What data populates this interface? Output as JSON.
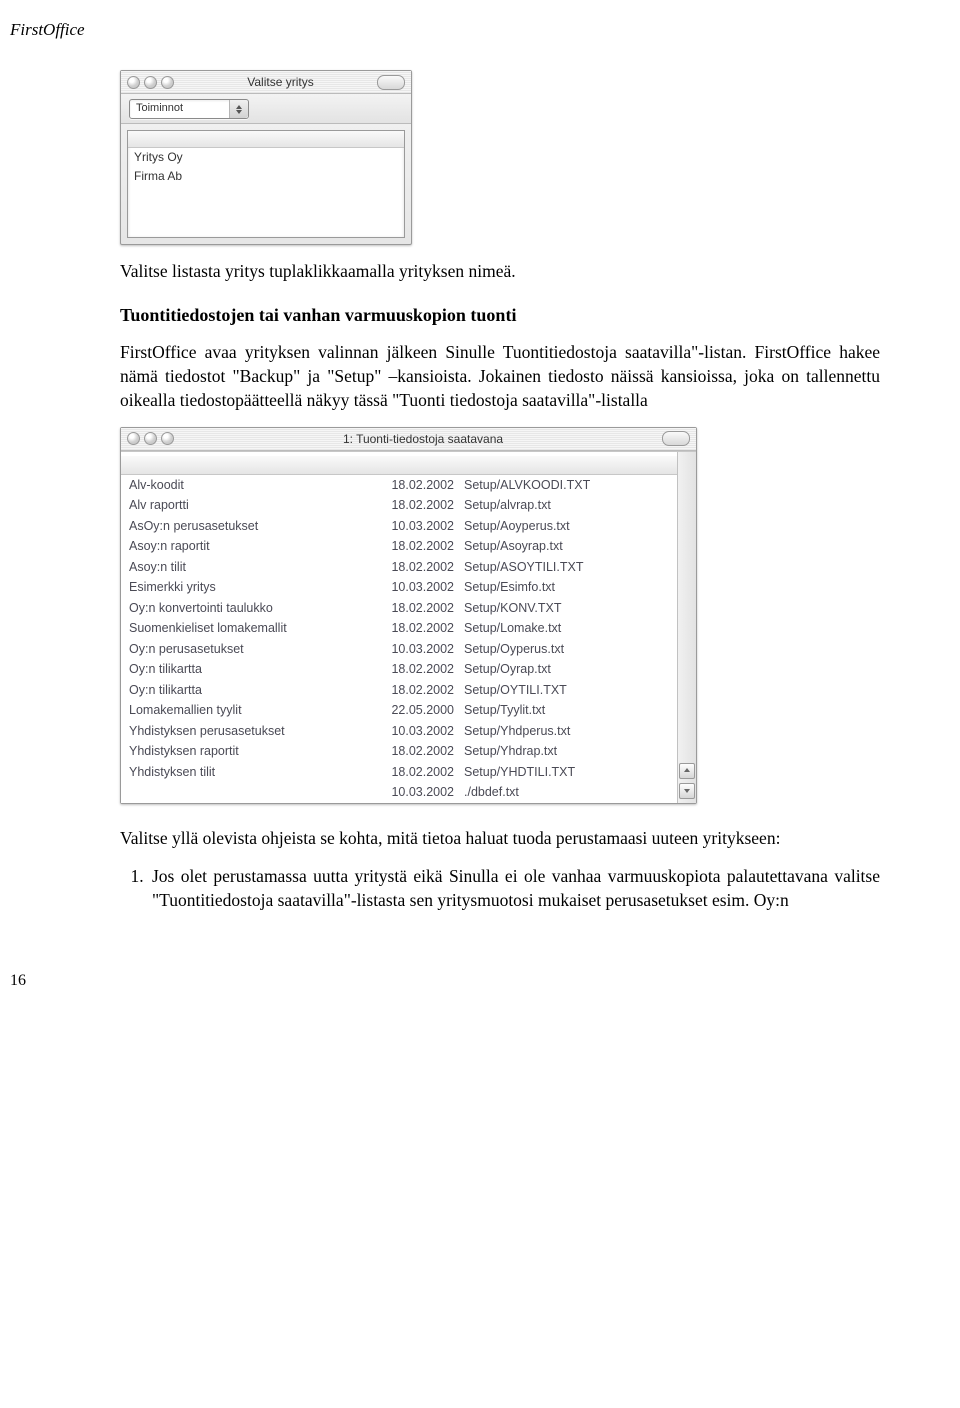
{
  "header": "FirstOffice",
  "page_number": "16",
  "window1": {
    "title": "Valitse yritys",
    "dropdown": "Toiminnot",
    "rows": [
      "Yritys Oy",
      "Firma Ab"
    ]
  },
  "para1": "Valitse listasta yritys tuplaklikkaamalla yrityksen nimeä.",
  "subheading": "Tuontitiedostojen tai vanhan varmuuskopion tuonti",
  "para2": "FirstOffice avaa yrityksen valinnan jälkeen Sinulle Tuontitiedostoja saatavilla\"-listan. FirstOffice hakee nämä tiedostot \"Backup\" ja \"Setup\" –kansioista. Jokainen tiedosto näissä kansioissa, joka on tallennettu oikealla tiedostopäätteellä näkyy tässä \"Tuonti tiedostoja saatavilla\"-listalla",
  "window2": {
    "title": "1: Tuonti-tiedostoja saatavana",
    "files": [
      {
        "name": "Alv-koodit",
        "date": "18.02.2002",
        "path": "Setup/ALVKOODI.TXT"
      },
      {
        "name": "Alv raportti",
        "date": "18.02.2002",
        "path": "Setup/alvrap.txt"
      },
      {
        "name": "AsOy:n perusasetukset",
        "date": "10.03.2002",
        "path": "Setup/Aoyperus.txt"
      },
      {
        "name": "Asoy:n raportit",
        "date": "18.02.2002",
        "path": "Setup/Asoyrap.txt"
      },
      {
        "name": "Asoy:n tilit",
        "date": "18.02.2002",
        "path": "Setup/ASOYTILI.TXT"
      },
      {
        "name": "Esimerkki yritys",
        "date": "10.03.2002",
        "path": "Setup/Esimfo.txt"
      },
      {
        "name": "Oy:n konvertointi taulukko",
        "date": "18.02.2002",
        "path": "Setup/KONV.TXT"
      },
      {
        "name": "Suomenkieliset lomakemallit",
        "date": "18.02.2002",
        "path": "Setup/Lomake.txt"
      },
      {
        "name": "Oy:n perusasetukset",
        "date": "10.03.2002",
        "path": "Setup/Oyperus.txt"
      },
      {
        "name": "Oy:n tilikartta",
        "date": "18.02.2002",
        "path": "Setup/Oyrap.txt"
      },
      {
        "name": "Oy:n tilikartta",
        "date": "18.02.2002",
        "path": "Setup/OYTILI.TXT"
      },
      {
        "name": "Lomakemallien tyylit",
        "date": "22.05.2000",
        "path": "Setup/Tyylit.txt"
      },
      {
        "name": "Yhdistyksen perusasetukset",
        "date": "10.03.2002",
        "path": "Setup/Yhdperus.txt"
      },
      {
        "name": "Yhdistyksen raportit",
        "date": "18.02.2002",
        "path": "Setup/Yhdrap.txt"
      },
      {
        "name": "Yhdistyksen tilit",
        "date": "18.02.2002",
        "path": "Setup/YHDTILI.TXT"
      },
      {
        "name": "",
        "date": "10.03.2002",
        "path": "./dbdef.txt"
      }
    ]
  },
  "para3": "Valitse yllä olevista ohjeista se kohta, mitä tietoa haluat tuoda perustamaasi uuteen yritykseen:",
  "list_item_1": "Jos olet perustamassa uutta yritystä eikä Sinulla ei ole vanhaa varmuuskopiota palautettavana valitse \"Tuontitiedostoja saatavilla\"-listasta sen yritysmuotosi mukaiset perusasetukset esim. Oy:n"
}
